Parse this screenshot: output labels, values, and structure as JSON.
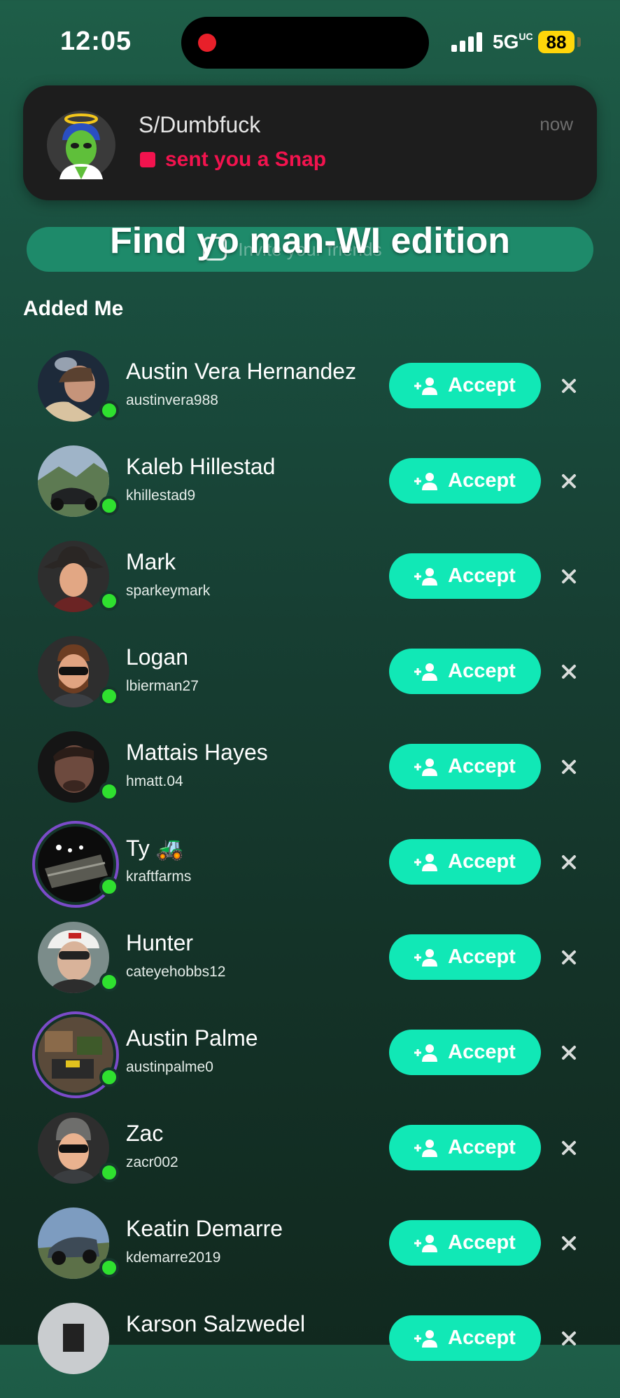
{
  "status_bar": {
    "time": "12:05",
    "network": "5G",
    "network_suffix": "UC",
    "battery": "88"
  },
  "notification": {
    "sender": "S/Dumbfuck",
    "message": "sent you a Snap",
    "time": "now",
    "accent_color": "#f2134e"
  },
  "overlay": {
    "title": "Find yo man-WI edition",
    "ghost_text": "Invite your friends"
  },
  "section": {
    "title": "Added Me"
  },
  "friends": [
    {
      "name": "Austin Vera Hernandez",
      "username": "austinvera988",
      "accept": "Accept"
    },
    {
      "name": "Kaleb Hillestad",
      "username": "khillestad9",
      "accept": "Accept"
    },
    {
      "name": "Mark",
      "username": "sparkeymark",
      "accept": "Accept"
    },
    {
      "name": "Logan",
      "username": "lbierman27",
      "accept": "Accept"
    },
    {
      "name": "Mattais Hayes",
      "username": "hmatt.04",
      "accept": "Accept"
    },
    {
      "name": "Ty 🚜",
      "username": "kraftfarms",
      "accept": "Accept"
    },
    {
      "name": "Hunter",
      "username": "cateyehobbs12",
      "accept": "Accept"
    },
    {
      "name": "Austin Palme",
      "username": "austinpalme0",
      "accept": "Accept"
    },
    {
      "name": "Zac",
      "username": "zacr002",
      "accept": "Accept"
    },
    {
      "name": "Keatin Demarre",
      "username": "kdemarre2019",
      "accept": "Accept"
    },
    {
      "name": "Karson  Salzwedel",
      "username": "",
      "accept": "Accept"
    }
  ],
  "colors": {
    "accept_button": "#11e8b6",
    "online": "#2fe02f",
    "story_ring": "#7b4bc9"
  }
}
